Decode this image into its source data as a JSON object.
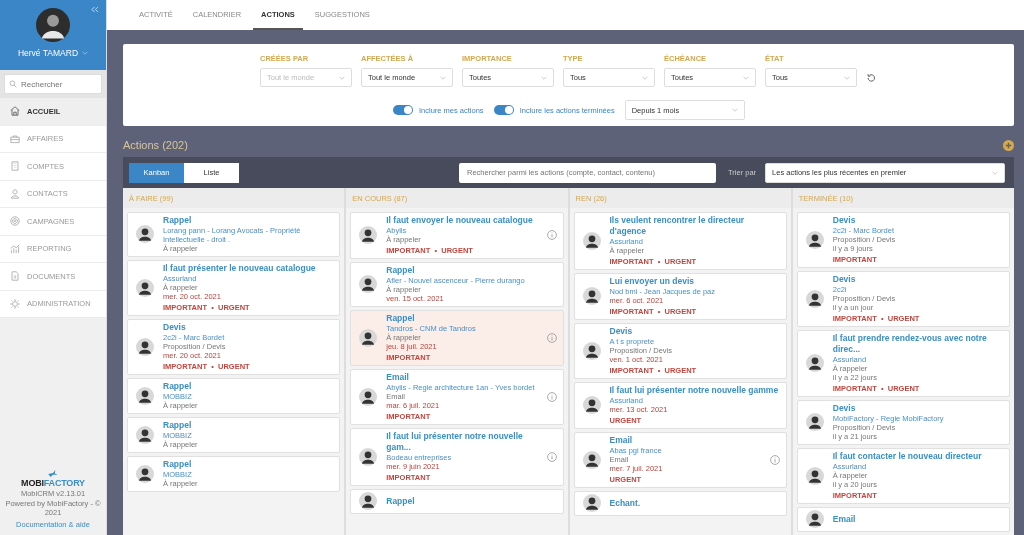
{
  "sidebar": {
    "user_name": "Hervé TAMARD",
    "search": {
      "placeholder": "Rechercher"
    },
    "items": [
      {
        "label": "ACCUEIL",
        "selected": true
      },
      {
        "label": "AFFAIRES",
        "selected": false
      },
      {
        "label": "COMPTES",
        "selected": false
      },
      {
        "label": "CONTACTS",
        "selected": false
      },
      {
        "label": "CAMPAGNES",
        "selected": false
      },
      {
        "label": "REPORTING",
        "selected": false
      },
      {
        "label": "DOCUMENTS",
        "selected": false
      },
      {
        "label": "ADMINISTRATION",
        "selected": false
      }
    ],
    "logo": {
      "first": "MOBI",
      "second": "FACTORY"
    },
    "version": "MobiCRM v2.13.01",
    "powered": "Powered by MobiFactory - © 2021",
    "help_link": "Documentation & aide"
  },
  "tabs": [
    {
      "label": "ACTIVITÉ",
      "selected": false
    },
    {
      "label": "CALENDRIER",
      "selected": false
    },
    {
      "label": "ACTIONS",
      "selected": true
    },
    {
      "label": "SUGGESTIONS",
      "selected": false
    }
  ],
  "filters": [
    {
      "label": "CRÉÉES PAR",
      "value": "Tout le monde",
      "disabled": true
    },
    {
      "label": "AFFECTÉES À",
      "value": "Tout le monde",
      "disabled": false
    },
    {
      "label": "IMPORTANCE",
      "value": "Toutes",
      "disabled": false
    },
    {
      "label": "TYPE",
      "value": "Tous",
      "disabled": false
    },
    {
      "label": "ÉCHÉANCE",
      "value": "Toutes",
      "disabled": false
    },
    {
      "label": "ÉTAT",
      "value": "Tous",
      "disabled": false
    }
  ],
  "toggles": [
    {
      "label": "Inclure mes actions",
      "on": true
    },
    {
      "label": "Inclure les actions terminées",
      "on": true
    }
  ],
  "period": "Depuis 1 mois",
  "section_title": "Actions (202)",
  "views": [
    {
      "label": "Kanban",
      "selected": true
    },
    {
      "label": "Liste",
      "selected": false
    }
  ],
  "search": {
    "placeholder": "Rechercher parmi les actions (compte, contact, contenu)"
  },
  "sort": {
    "label": "Trier par",
    "value": "Les actions les plus récentes en premier"
  },
  "columns": [
    {
      "title": "À FAIRE (99)",
      "cards": [
        {
          "title": "Rappel",
          "company": "Lorang pann - Lorang Avocats - Propriété Intellectuelle - droit .",
          "status": "À rappeler",
          "info": false,
          "highlighted": false
        },
        {
          "title": "Il faut présenter le nouveau catalogue",
          "company": "Assurland",
          "status": "À rappeler",
          "due": {
            "text": "mer. 20 oct. 2021",
            "overdue": true
          },
          "tags": "IMPORTANT  •  URGENT",
          "info": false,
          "highlighted": false
        },
        {
          "title": "Devis",
          "company": "2c2i - Marc Bordet",
          "status": "Proposition / Devis",
          "due": {
            "text": "mer. 20 oct. 2021",
            "overdue": true
          },
          "tags": "IMPORTANT  •  URGENT",
          "info": false,
          "highlighted": false
        },
        {
          "title": "Rappel",
          "company": "MOBBIZ",
          "status": "À rappeler",
          "info": false,
          "highlighted": false
        },
        {
          "title": "Rappel",
          "company": "MOBBIZ",
          "status": "À rappeler",
          "info": false,
          "highlighted": false
        },
        {
          "title": "Rappel",
          "company": "MOBBIZ",
          "status": "À rappeler",
          "info": false,
          "highlighted": false
        }
      ]
    },
    {
      "title": "EN COURS (87)",
      "cards": [
        {
          "title": "Il faut envoyer le nouveau catalogue",
          "company": "Abylis",
          "status": "À rappeler",
          "tags": "IMPORTANT  •  URGENT",
          "info": true,
          "highlighted": false
        },
        {
          "title": "Rappel",
          "company": "Afler - Nouvel ascenceur - Pierre durango",
          "status": "À rappeler",
          "due": {
            "text": "ven. 15 oct. 2021",
            "overdue": true
          },
          "info": false,
          "highlighted": false
        },
        {
          "title": "Rappel",
          "company": "Tandros - CNM de Tandros",
          "status": "À rappeler",
          "due": {
            "text": "jeu. 8 juil. 2021",
            "overdue": true
          },
          "tags": "IMPORTANT",
          "info": true,
          "highlighted": true
        },
        {
          "title": "Email",
          "company": "Abylis - Regie architecture 1an - Yves bordet",
          "status": "Email",
          "due": {
            "text": "mar. 6 juil. 2021",
            "overdue": true
          },
          "tags": "IMPORTANT",
          "info": true,
          "highlighted": false
        },
        {
          "title": "Il faut lui présenter notre nouvelle gam...",
          "company": "Bodeau entreprises",
          "due": {
            "text": "mer. 9 juin 2021",
            "overdue": true
          },
          "tags": "IMPORTANT",
          "info": true,
          "highlighted": false
        },
        {
          "title": "Rappel",
          "info": false,
          "highlighted": false
        }
      ]
    },
    {
      "title": "REN (26)",
      "cards": [
        {
          "title": "Ils veulent rencontrer le directeur d'agence",
          "company": "Assurland",
          "status": "À rappeler",
          "tags": "IMPORTANT  •  URGENT",
          "info": false,
          "highlighted": false
        },
        {
          "title": "Lui envoyer un devis",
          "company": "Nod bmi - Jean Jacques de paz",
          "due": {
            "text": "mer. 6 oct. 2021",
            "overdue": true
          },
          "tags": "IMPORTANT  •  URGENT",
          "info": false,
          "highlighted": false
        },
        {
          "title": "Devis",
          "company": "A t s proprete",
          "status": "Proposition / Devis",
          "due": {
            "text": "ven. 1 oct. 2021",
            "overdue": true
          },
          "tags": "IMPORTANT  •  URGENT",
          "info": false,
          "highlighted": false
        },
        {
          "title": "Il faut lui présenter notre nouvelle gamme",
          "company": "Assurland",
          "due": {
            "text": "mer. 13 oct. 2021",
            "overdue": true
          },
          "tags": "URGENT",
          "info": false,
          "highlighted": false
        },
        {
          "title": "Email",
          "company": "Abas pgi france",
          "status": "Email",
          "due": {
            "text": "mer. 7 juil. 2021",
            "overdue": true
          },
          "tags": "URGENT",
          "info": true,
          "highlighted": false
        },
        {
          "title": "Echant.",
          "info": false,
          "highlighted": false
        }
      ]
    },
    {
      "title": "TERMINÉE (10)",
      "cards": [
        {
          "title": "Devis",
          "company": "2c2i - Marc Bordet",
          "status": "Proposition / Devis",
          "due": {
            "text": "il y a 9 jours",
            "overdue": false
          },
          "tags": "IMPORTANT",
          "info": false,
          "highlighted": false
        },
        {
          "title": "Devis",
          "company": "2c2i",
          "status": "Proposition / Devis",
          "due": {
            "text": "il y a un jour",
            "overdue": false
          },
          "tags": "IMPORTANT  •  URGENT",
          "info": false,
          "highlighted": false
        },
        {
          "title": "Il faut prendre rendez-vous avec notre direc...",
          "company": "Assurland",
          "status": "À rappeler",
          "due": {
            "text": "il y a 22 jours",
            "overdue": false
          },
          "tags": "IMPORTANT  •  URGENT",
          "info": false,
          "highlighted": false
        },
        {
          "title": "Devis",
          "company": "MobiFactory - Regie MobiFactory",
          "status": "Proposition / Devis",
          "due": {
            "text": "il y a 21 jours",
            "overdue": false
          },
          "info": false,
          "highlighted": false
        },
        {
          "title": "Il faut contacter le nouveau directeur",
          "company": "Assurland",
          "status": "À rappeler",
          "due": {
            "text": "il y a 20 jours",
            "overdue": false
          },
          "tags": "IMPORTANT",
          "info": false,
          "highlighted": false
        },
        {
          "title": "Email",
          "info": false,
          "highlighted": false
        }
      ]
    }
  ]
}
